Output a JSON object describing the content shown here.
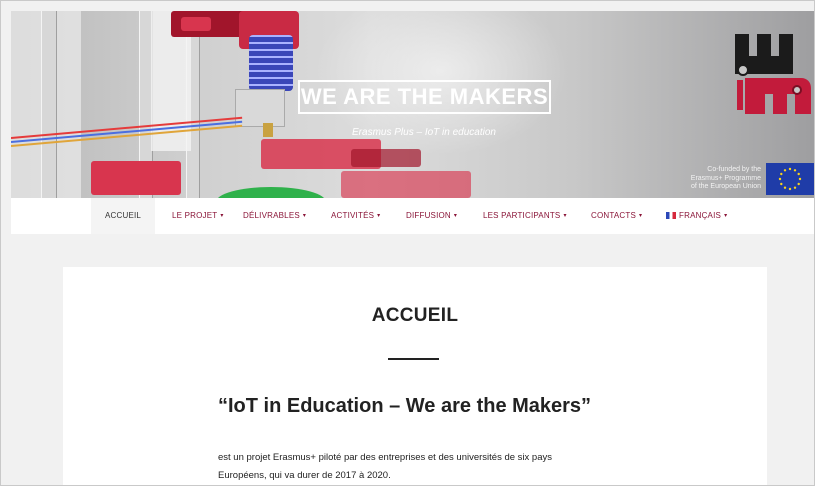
{
  "header": {
    "title": "WE ARE THE MAKERS",
    "subtitle": "Erasmus Plus – IoT in education",
    "cofunded_lines": [
      "Co-funded by the",
      "Erasmus+ Programme",
      "of the European Union"
    ],
    "logo_icon": "we-are-the-makers-logo",
    "flag_icon": "eu-flag-icon"
  },
  "nav": {
    "items": [
      {
        "label": "ACCUEIL",
        "dropdown": false,
        "active": true
      },
      {
        "label": "LE PROJET",
        "dropdown": true
      },
      {
        "label": "DÉLIVRABLES",
        "dropdown": true
      },
      {
        "label": "ACTIVITÉS",
        "dropdown": true
      },
      {
        "label": "DIFFUSION",
        "dropdown": true
      },
      {
        "label": "LES PARTICIPANTS",
        "dropdown": true
      },
      {
        "label": "CONTACTS",
        "dropdown": true
      },
      {
        "label": "FRANÇAIS",
        "dropdown": true,
        "icon": "flag-fr-icon"
      }
    ],
    "caret": "▾"
  },
  "main": {
    "page_title": "ACCUEIL",
    "quote_title": "“IoT in Education – We are the Makers”",
    "paragraph_lines": [
      "est un projet Erasmus+ piloté par des entreprises et des universités de six pays",
      "Européens, qui va durer de 2017 à 2020."
    ]
  },
  "colors": {
    "accent": "#8a1538",
    "text": "#222222",
    "page_bg": "#f1f1f1"
  }
}
